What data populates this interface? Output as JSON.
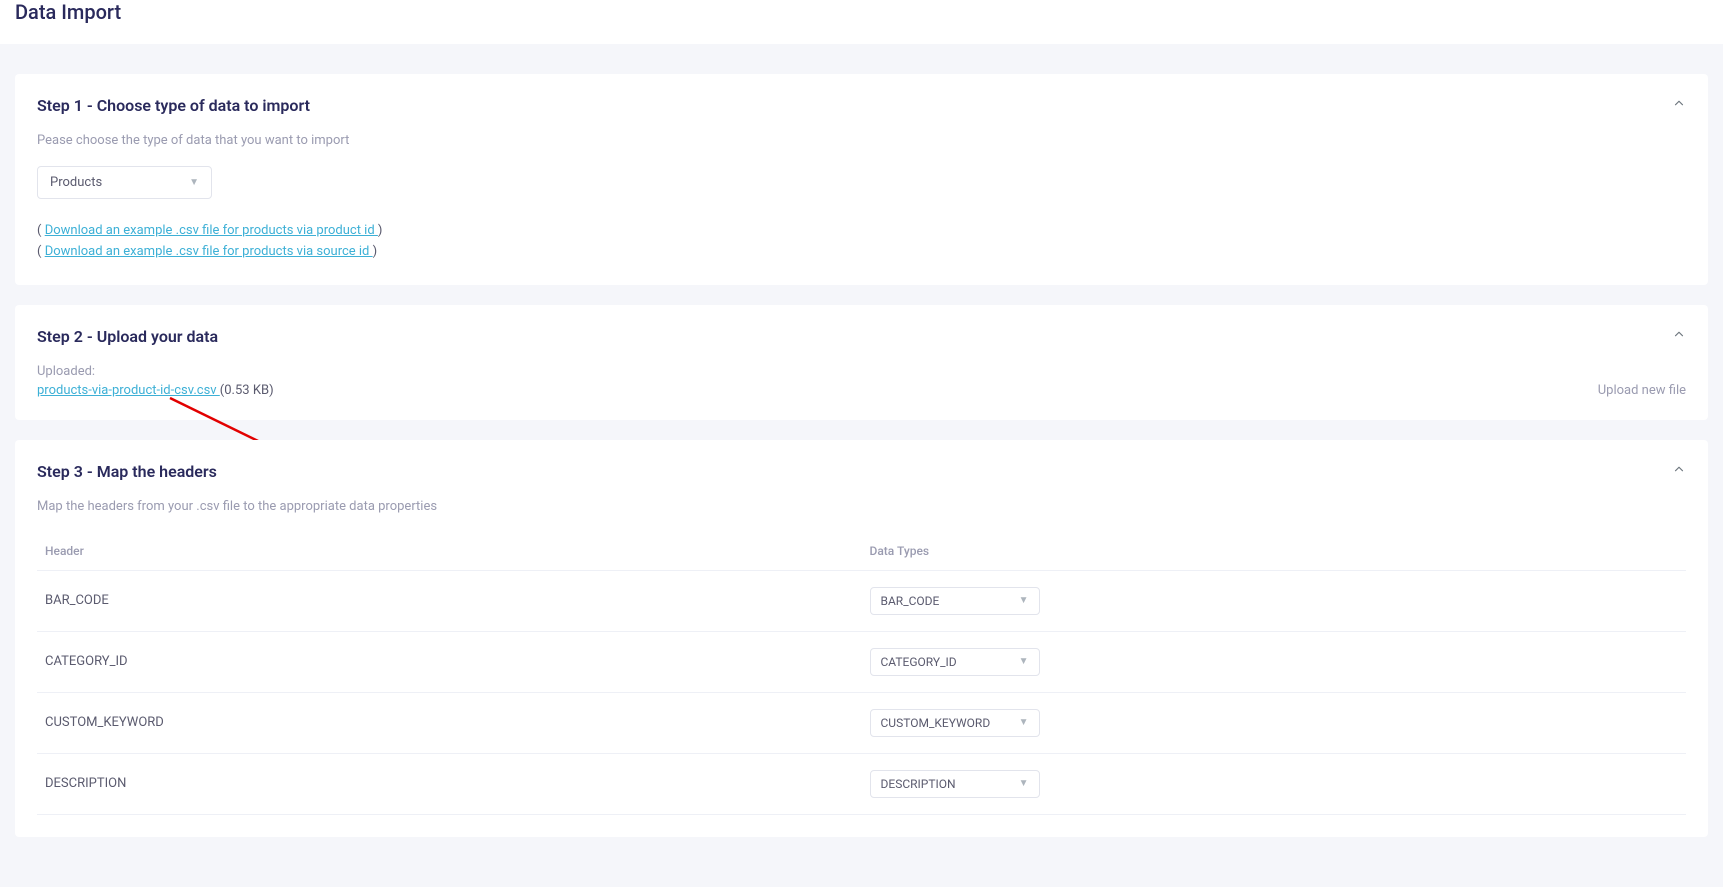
{
  "page_title": "Data Import",
  "step1": {
    "title": "Step 1 - Choose type of data to import",
    "subtitle": "Pease choose the type of data that you want to import",
    "select_value": "Products",
    "download1_prefix": "( ",
    "download1_link": " Download an example .csv file for products via product id ",
    "download1_suffix": ")",
    "download2_prefix": "( ",
    "download2_link": " Download an example .csv file for products via source id ",
    "download2_suffix": ")"
  },
  "step2": {
    "title": "Step 2 - Upload your data",
    "uploaded_label": "Uploaded:",
    "file_name": "products-via-product-id-csv.csv ",
    "file_size": "(0.53 KB)",
    "upload_new": "Upload new file"
  },
  "step3": {
    "title": "Step 3 - Map the headers",
    "subtitle": "Map the headers from your .csv file to the appropriate data properties",
    "col_header": "Header",
    "col_datatype": "Data Types",
    "rows": [
      {
        "header": "BAR_CODE",
        "datatype": "BAR_CODE"
      },
      {
        "header": "CATEGORY_ID",
        "datatype": "CATEGORY_ID"
      },
      {
        "header": "CUSTOM_KEYWORD",
        "datatype": "CUSTOM_KEYWORD"
      },
      {
        "header": "DESCRIPTION",
        "datatype": "DESCRIPTION"
      }
    ]
  }
}
